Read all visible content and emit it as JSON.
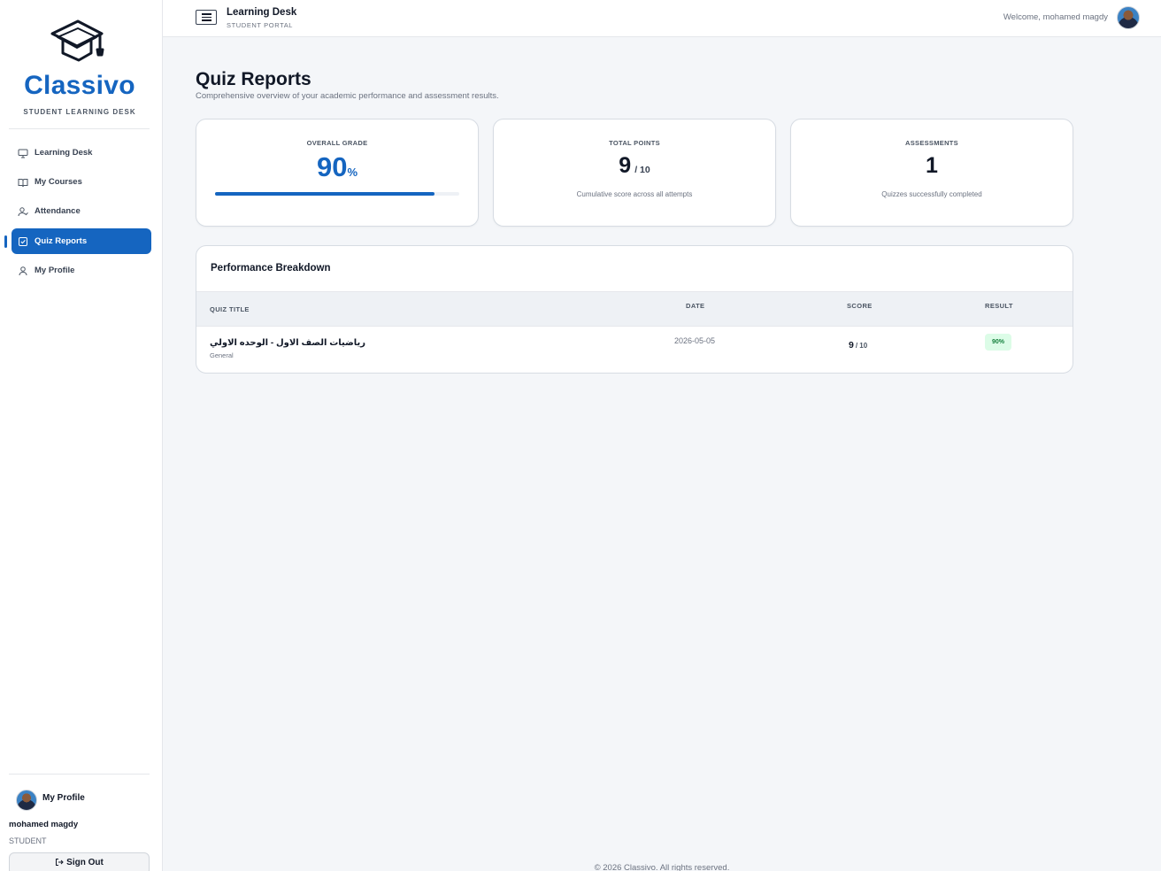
{
  "brand": {
    "name": "Classivo",
    "tagline": "STUDENT LEARNING DESK",
    "accent": "#1565c0"
  },
  "sidebar": {
    "items": [
      {
        "label": "Learning Desk",
        "icon": "monitor-icon",
        "active": false
      },
      {
        "label": "My Courses",
        "icon": "book-icon",
        "active": false
      },
      {
        "label": "Attendance",
        "icon": "user-check-icon",
        "active": false
      },
      {
        "label": "Quiz Reports",
        "icon": "checkbox-icon",
        "active": true
      },
      {
        "label": "My Profile",
        "icon": "user-icon",
        "active": false
      }
    ],
    "profile": {
      "title": "My Profile",
      "name": "mohamed magdy",
      "role": "STUDENT",
      "signout_label": "Sign Out"
    }
  },
  "topbar": {
    "title": "Learning Desk",
    "subtitle": "STUDENT PORTAL",
    "welcome": "Welcome, mohamed magdy"
  },
  "page": {
    "title": "Quiz Reports",
    "subtitle": "Comprehensive overview of your academic performance and assessment results."
  },
  "stats": {
    "overall": {
      "label": "OVERALL GRADE",
      "value": "90",
      "unit": "%",
      "progress_percent": 90
    },
    "points": {
      "label": "TOTAL POINTS",
      "value": "9",
      "total": "/ 10",
      "note": "Cumulative score across all attempts"
    },
    "assessments": {
      "label": "ASSESSMENTS",
      "value": "1",
      "note": "Quizzes successfully completed"
    }
  },
  "breakdown": {
    "title": "Performance Breakdown",
    "columns": [
      "QUIZ TITLE",
      "DATE",
      "SCORE",
      "RESULT"
    ],
    "rows": [
      {
        "title": "رياضيات الصف الاول - الوحده الاولي",
        "category": "General",
        "date": "2026-05-05",
        "score": "9",
        "total": "/ 10",
        "result": "90%",
        "result_color": "#15803d"
      }
    ]
  },
  "footer": {
    "text": "© 2026 Classivo. All rights reserved."
  }
}
